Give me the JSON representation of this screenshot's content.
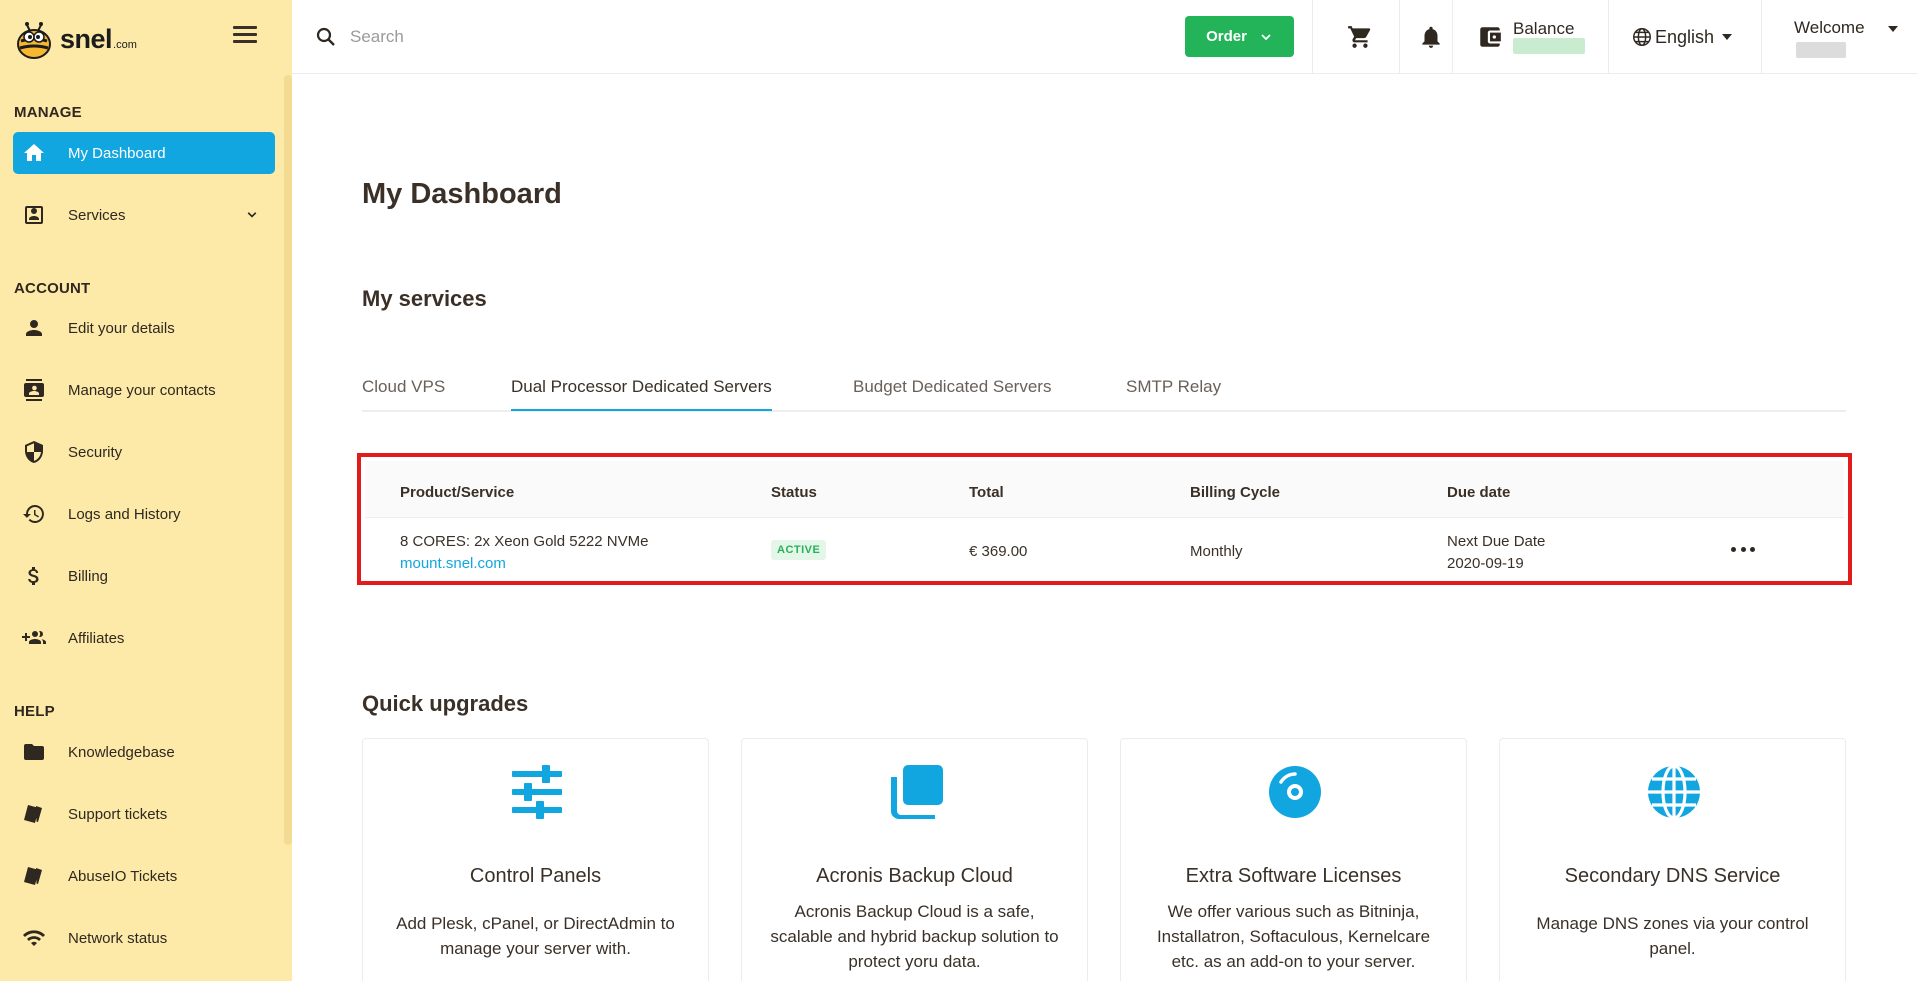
{
  "brand": {
    "name": "snel",
    "suffix": ".com"
  },
  "sidebar": {
    "sections": [
      {
        "title": "MANAGE",
        "items": [
          {
            "label": "My Dashboard",
            "icon": "home-icon",
            "active": true
          },
          {
            "label": "Services",
            "icon": "account-box-icon",
            "expandable": true
          }
        ]
      },
      {
        "title": "ACCOUNT",
        "items": [
          {
            "label": "Edit your details",
            "icon": "person-icon"
          },
          {
            "label": "Manage your contacts",
            "icon": "contacts-icon"
          },
          {
            "label": "Security",
            "icon": "shield-icon"
          },
          {
            "label": "Logs and History",
            "icon": "history-icon"
          },
          {
            "label": "Billing",
            "icon": "dollar-icon"
          },
          {
            "label": "Affiliates",
            "icon": "group-add-icon"
          }
        ]
      },
      {
        "title": "HELP",
        "items": [
          {
            "label": "Knowledgebase",
            "icon": "folder-icon"
          },
          {
            "label": "Support tickets",
            "icon": "ticket-icon"
          },
          {
            "label": "AbuseIO Tickets",
            "icon": "ticket-icon"
          },
          {
            "label": "Network status",
            "icon": "wifi-icon"
          }
        ]
      }
    ]
  },
  "topbar": {
    "search_placeholder": "Search",
    "order_label": "Order",
    "balance_label": "Balance",
    "language": "English",
    "welcome_label": "Welcome"
  },
  "main": {
    "page_title": "My Dashboard",
    "services_heading": "My services",
    "tabs": [
      {
        "label": "Cloud VPS",
        "active": false
      },
      {
        "label": "Dual Processor Dedicated Servers",
        "active": true
      },
      {
        "label": "Budget Dedicated Servers",
        "active": false
      },
      {
        "label": "SMTP Relay",
        "active": false
      }
    ],
    "table": {
      "headers": [
        "Product/Service",
        "Status",
        "Total",
        "Billing Cycle",
        "Due date"
      ],
      "rows": [
        {
          "product": "8 CORES: 2x Xeon Gold 5222 NVMe",
          "domain": "mount.snel.com",
          "status": "ACTIVE",
          "total": "€ 369.00",
          "billing_cycle": "Monthly",
          "due_label": "Next Due Date",
          "due_date": "2020-09-19"
        }
      ]
    },
    "upgrades_heading": "Quick upgrades",
    "upgrades": [
      {
        "title": "Control Panels",
        "desc": "Add Plesk, cPanel, or DirectAdmin to manage your server with.",
        "icon": "sliders-icon"
      },
      {
        "title": "Acronis Backup Cloud",
        "desc": "Acronis Backup Cloud is a safe, scalable and hybrid backup solution to protect yoru data.",
        "icon": "copy-stack-icon"
      },
      {
        "title": "Extra Software Licenses",
        "desc": "We offer various such as Bitninja, Installatron, Softaculous, Kernelcare etc. as an add-on to your server.",
        "icon": "disc-icon"
      },
      {
        "title": "Secondary DNS Service",
        "desc": "Manage DNS zones via your control panel.",
        "icon": "globe-icon"
      }
    ]
  },
  "colors": {
    "sidebar_bg": "#fdeaa8",
    "accent": "#11a6e0",
    "order_green": "#23b45a",
    "highlight_red": "#e21b1b",
    "text": "#3a3027"
  }
}
